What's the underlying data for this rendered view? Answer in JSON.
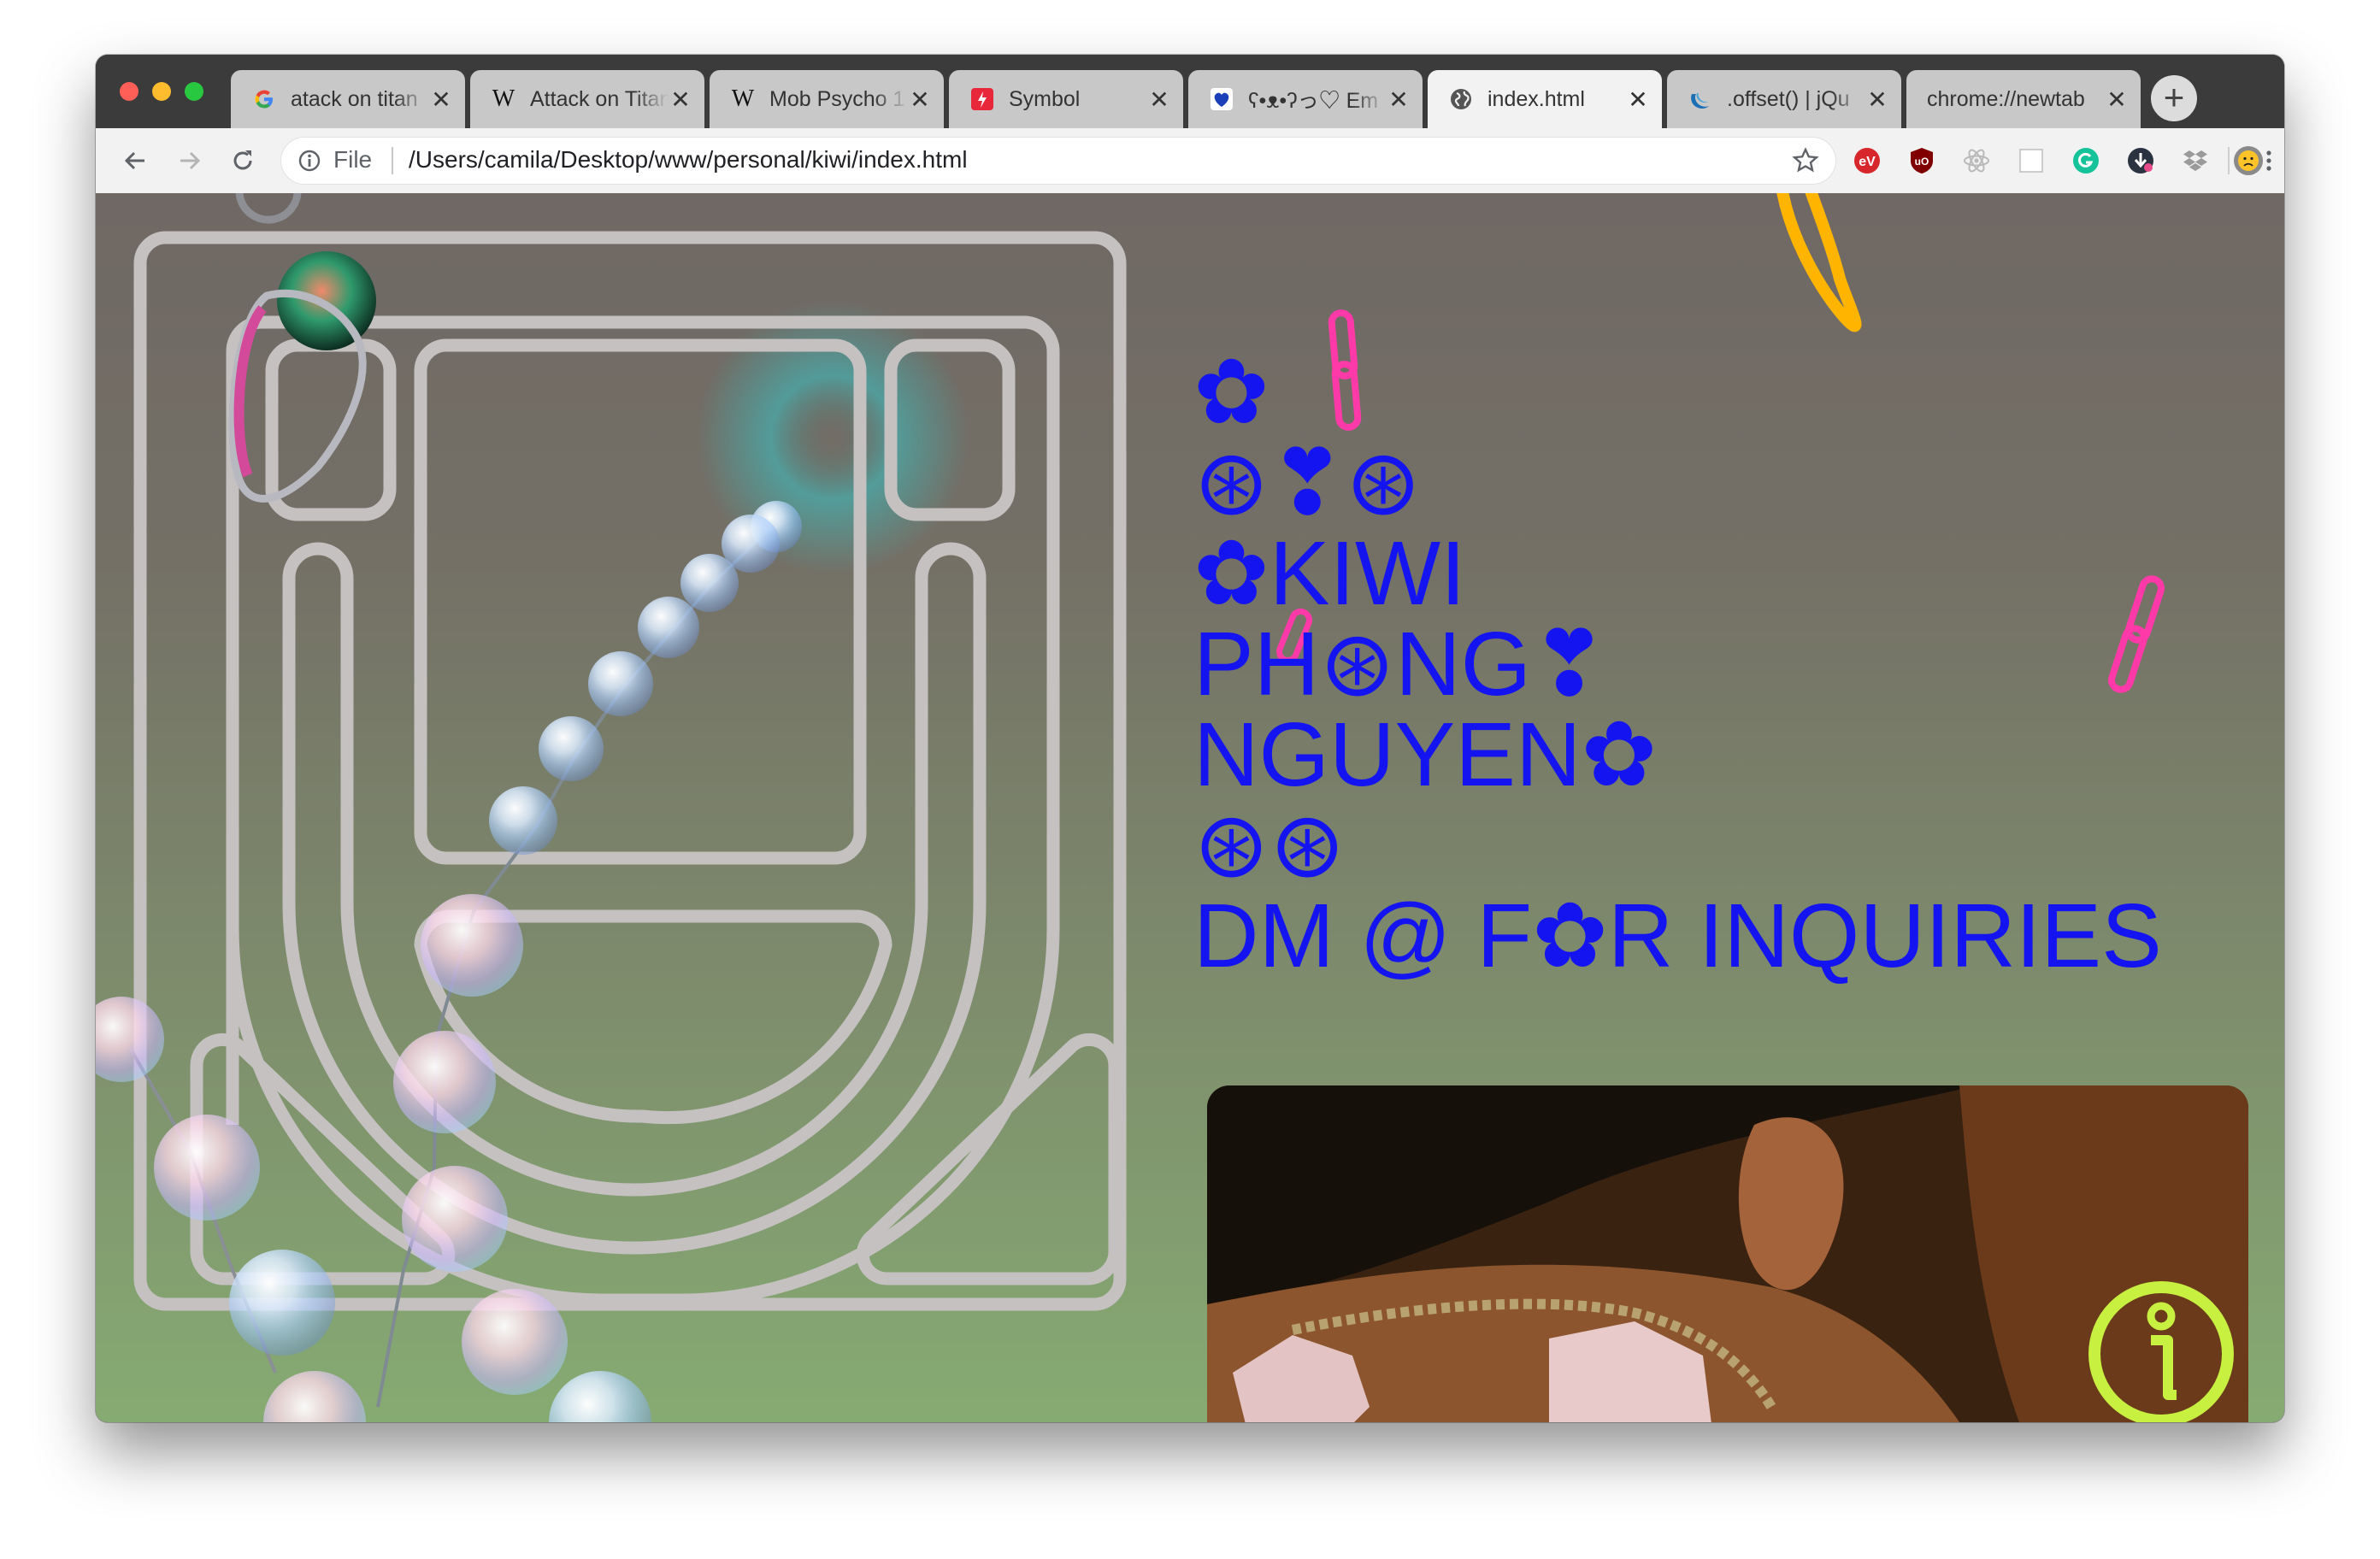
{
  "browser": {
    "tabs": [
      {
        "title": "atack on titan",
        "favicon": "google-icon",
        "active": false
      },
      {
        "title": "Attack on Titan",
        "favicon": "wikipedia-icon",
        "active": false
      },
      {
        "title": "Mob Psycho 1",
        "favicon": "wikipedia-icon",
        "active": false
      },
      {
        "title": "Symbol",
        "favicon": "symbol-app-icon",
        "active": false
      },
      {
        "title": "ʕ•ᴥ•ʔっ♡ Em",
        "favicon": "heart-icon",
        "active": false
      },
      {
        "title": "index.html",
        "favicon": "globe-icon",
        "active": true
      },
      {
        "title": ".offset() | jQu",
        "favicon": "jquery-icon",
        "active": false
      },
      {
        "title": "chrome://newtab",
        "favicon": "",
        "active": false
      }
    ],
    "close_glyph": "✕",
    "new_tab_glyph": "+",
    "omnibox": {
      "scheme_label": "File",
      "url": "/Users/camila/Desktop/www/personal/kiwi/index.html"
    },
    "extensions": [
      "ev-icon",
      "ublock-icon",
      "react-icon",
      "page-icon",
      "grammarly-icon",
      "download-icon",
      "dropbox-icon",
      "profile-avatar-icon"
    ]
  },
  "page": {
    "headline_lines": [
      "✿",
      "⊛❣⊛",
      "✿KIWI",
      "PH⊛NG❣",
      "NGUYEN✿",
      "⊛⊛",
      "DM @ F✿R INQUIRIES"
    ],
    "colors": {
      "headline": "#1414f0",
      "outline_logo": "#c4c1c0",
      "info_button": "#c8f040",
      "chain_pink": "#ff3aa8",
      "ring_orange": "#ffb400"
    }
  }
}
